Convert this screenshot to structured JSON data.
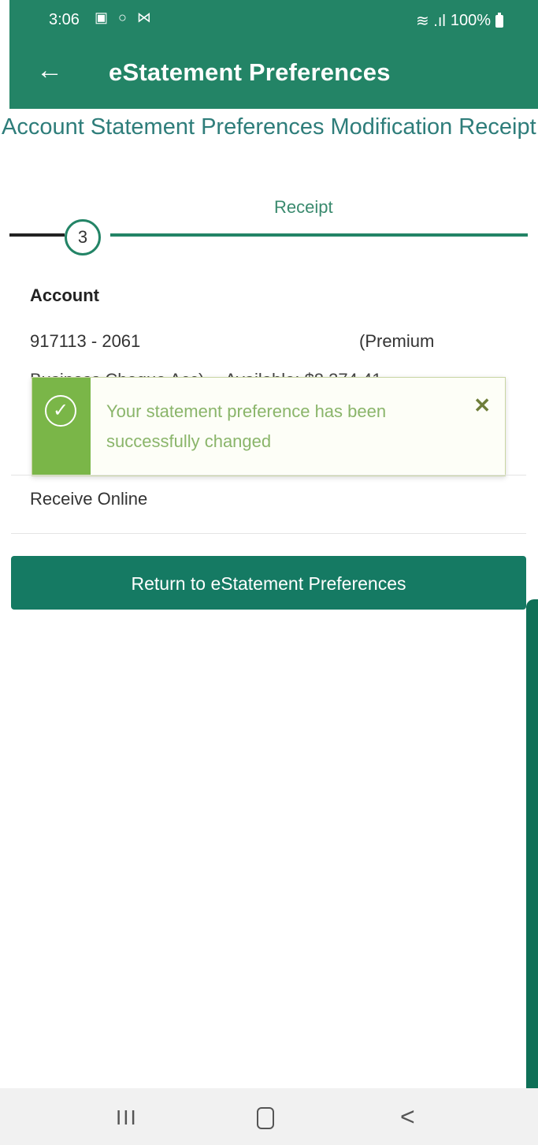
{
  "status_bar": {
    "time": "3:06",
    "left_icons": "▣ ○ ⋈",
    "signal": "≋ .ıl",
    "battery": "100%"
  },
  "app_bar": {
    "back_icon": "←",
    "title": "eStatement Preferences"
  },
  "page": {
    "heading": "Account Statement Preferences Modification Receipt"
  },
  "stepper": {
    "step_number": "3",
    "step_label": "Receipt"
  },
  "account": {
    "label": "Account",
    "number": "917113 - 2061",
    "type_start": "(Premium",
    "line2_name": "Business Cheque Acc)",
    "line2_available": "Available: $8,374.41"
  },
  "toast": {
    "icon": "✓",
    "message": "Your statement preference has been successfully changed",
    "close": "✕"
  },
  "delivery": {
    "value": "Receive Online"
  },
  "actions": {
    "return_label": "Return to eStatement Preferences"
  },
  "nav": {
    "recent": "III",
    "back": "<"
  },
  "colors": {
    "brand_green": "#238466",
    "button_green": "#157a63",
    "success_green": "#7ab648"
  }
}
